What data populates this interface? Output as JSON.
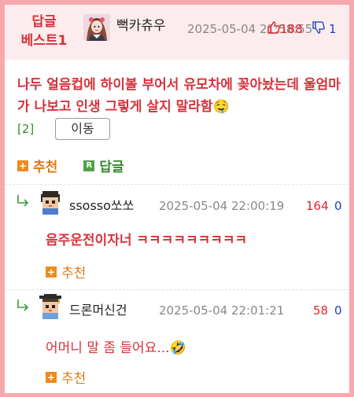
{
  "best": {
    "label_line1": "답글",
    "label_line2": "베스트1",
    "nickname": "뻑카츄우",
    "date": "2025-05-04 21:58:55",
    "upvotes": "188",
    "downvotes": "1",
    "body": "나두 얼음컵에 하이볼 부어서 유모차에 꽂아놨는데 울엄마가 나보고 인생 그렇게 살지 말라함🤤",
    "reply_count": "[2]",
    "move_label": "이동",
    "recommend_label": "추천",
    "reply_label": "답글",
    "recommend_icon": "plus-box-icon",
    "reply_icon": "r-box-icon"
  },
  "replies": [
    {
      "nickname": "ssosso쏘쏘",
      "date": "2025-05-04 22:00:19",
      "upvotes": "164",
      "downvotes": "0",
      "text": "음주운전이자너 ㅋㅋㅋㅋㅋㅋㅋㅋㅋ",
      "recommend_label": "추천"
    },
    {
      "nickname": "드론머신건",
      "date": "2025-05-04 22:01:21",
      "upvotes": "58",
      "downvotes": "0",
      "text": "어머니 말 좀 들어요...🤣",
      "recommend_label": "추천"
    }
  ],
  "colors": {
    "frame": "#f8a8ad",
    "best_bg": "#fdecee",
    "accent_red": "#d6323a",
    "recommend_orange": "#e07a14",
    "reply_green": "#3a8a2e",
    "down_blue": "#1a3fc6"
  }
}
